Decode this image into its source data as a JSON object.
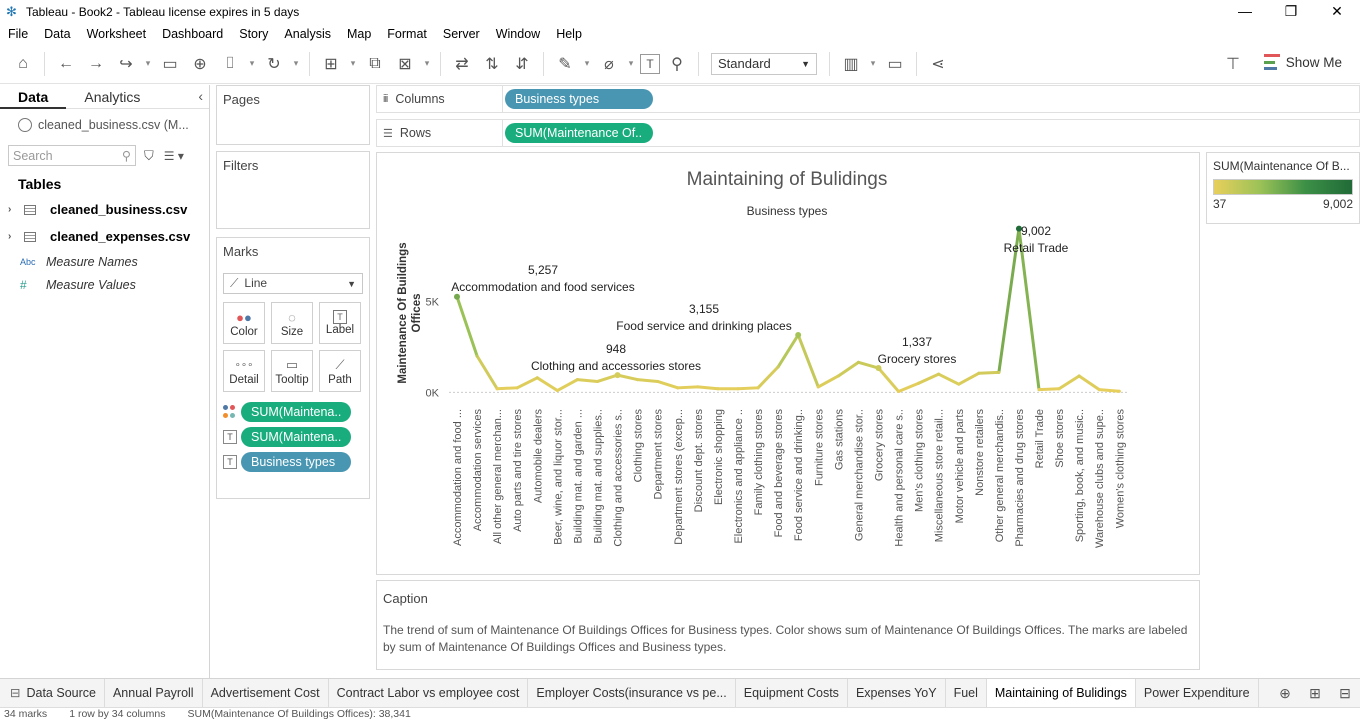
{
  "window": {
    "title": "Tableau - Book2 - Tableau license expires in 5 days",
    "min": "—",
    "max": "❐",
    "close": "✕"
  },
  "menu": [
    "File",
    "Data",
    "Worksheet",
    "Dashboard",
    "Story",
    "Analysis",
    "Map",
    "Format",
    "Server",
    "Window",
    "Help"
  ],
  "toolbar": {
    "fit": "Standard",
    "show_me": "Show Me"
  },
  "data_pane": {
    "tab_data": "Data",
    "tab_analytics": "Analytics",
    "source": "cleaned_business.csv (M...",
    "search_placeholder": "Search",
    "tables_header": "Tables",
    "tables": [
      "cleaned_business.csv",
      "cleaned_expenses.csv"
    ],
    "measure_names_icon": "Abc",
    "measure_names": "Measure Names",
    "measure_values_icon": "#",
    "measure_values": "Measure Values"
  },
  "cards": {
    "pages": "Pages",
    "filters": "Filters",
    "marks": "Marks",
    "mark_type": "Line",
    "mark_buttons": [
      "Color",
      "Size",
      "Label",
      "Detail",
      "Tooltip",
      "Path"
    ],
    "mark_pills": [
      "SUM(Maintena..",
      "SUM(Maintena..",
      "Business types"
    ]
  },
  "shelves": {
    "columns_label": "Columns",
    "columns_pill": "Business types",
    "rows_label": "Rows",
    "rows_pill": "SUM(Maintenance Of.."
  },
  "legend": {
    "title": "SUM(Maintenance Of B...",
    "min": "37",
    "max": "9,002"
  },
  "caption": {
    "title": "Caption",
    "text": "The trend of sum of Maintenance Of Buildings Offices for Business types.  Color shows sum of Maintenance Of Buildings Offices.  The marks are labeled by sum of Maintenance Of Buildings Offices and Business types."
  },
  "tabs": {
    "data_source": "Data Source",
    "sheets": [
      "Annual Payroll",
      "Advertisement Cost",
      "Contract Labor vs employee cost",
      "Employer Costs(insurance vs pe...",
      "Equipment Costs",
      "Expenses YoY",
      "Fuel",
      "Maintaining of Bulidings",
      "Power Expenditure"
    ],
    "active": "Maintaining of Bulidings"
  },
  "status": {
    "marks": "34 marks",
    "dims": "1 row by 34 columns",
    "sum": "SUM(Maintenance Of Buildings Offices): 38,341"
  },
  "colors": {
    "pill_green": "#19ad7e",
    "pill_blue": "#4996b2",
    "low": "#e8cf5c",
    "high": "#216b38"
  },
  "chart_data": {
    "type": "line",
    "title": "Maintaining of Bulidings",
    "xlabel": "Business types",
    "ylabel": "Maintenance Of Buildings Offices",
    "y_ticks": [
      "0K",
      "5K"
    ],
    "ylim": [
      -200,
      9200
    ],
    "categories": [
      "Accommodation and food ...",
      "Accommodation services",
      "All other general merchan...",
      "Auto parts and tire stores",
      "Automobile dealers",
      "Beer, wine, and liquor stor...",
      "Building mat. and garden ...",
      "Building mat. and supplies..",
      "Clothing and accessories s..",
      "Clothing stores",
      "Department stores",
      "Department stores (excep...",
      "Discount dept. stores",
      "Electronic shopping",
      "Electronics and appliance ..",
      "Family clothing stores",
      "Food and beverage stores",
      "Food service and drinking..",
      "Furniture stores",
      "Gas stations",
      "General merchandise stor..",
      "Grocery stores",
      "Health and personal care s..",
      "Men's clothing stores",
      "Miscellaneous store retail...",
      "Motor vehicle and parts",
      "Nonstore retailers",
      "Other general merchandis..",
      "Pharmacies and drug stores",
      "Retail Trade",
      "Shoe stores",
      "Sporting, book, and music..",
      "Warehouse clubs and supe..",
      "Women's clothing stores"
    ],
    "values": [
      5257,
      2000,
      200,
      250,
      800,
      100,
      700,
      600,
      948,
      700,
      600,
      250,
      300,
      200,
      200,
      250,
      1400,
      3155,
      300,
      900,
      1650,
      1337,
      50,
      500,
      1000,
      450,
      1050,
      1100,
      9002,
      150,
      200,
      900,
      150,
      60
    ],
    "annotations": [
      {
        "index": 0,
        "value": "5,257",
        "label": "Accommodation and food services"
      },
      {
        "index": 8,
        "value": "948",
        "label": "Clothing and accessories stores"
      },
      {
        "index": 17,
        "value": "3,155",
        "label": "Food service and drinking places"
      },
      {
        "index": 21,
        "value": "1,337",
        "label": "Grocery stores"
      },
      {
        "index": 28,
        "value": "9,002",
        "label": "Retail Trade"
      }
    ]
  }
}
